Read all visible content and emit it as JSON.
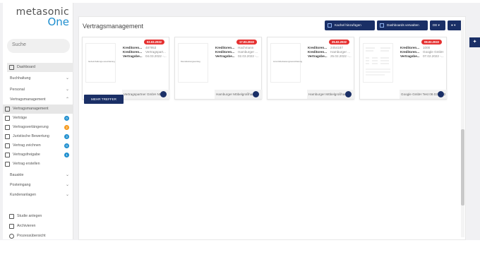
{
  "logo": {
    "top": "metasonic",
    "bottom": "One"
  },
  "search": {
    "placeholder": "Suche"
  },
  "sidebar": {
    "items": [
      {
        "label": "Dashboard"
      },
      {
        "label": "Buchhaltung"
      },
      {
        "label": "Personal"
      },
      {
        "label": "Vertragsmanagement"
      },
      {
        "label": "Vertragsmanagement"
      },
      {
        "label": "Verträge",
        "badge": "0"
      },
      {
        "label": "Vertragsverlängerung",
        "badge": "2"
      },
      {
        "label": "Juristische Bewertung",
        "badge": "3"
      },
      {
        "label": "Vertrag zeichnen",
        "badge": "0"
      },
      {
        "label": "Vertragsfreigabe",
        "badge": "1"
      },
      {
        "label": "Vertrag erstellen"
      },
      {
        "label": "Bauakte"
      },
      {
        "label": "Posteingang"
      },
      {
        "label": "Kundenanlagen"
      },
      {
        "label": "Studie anlegen"
      },
      {
        "label": "Archivieren"
      },
      {
        "label": "Prozessübersicht"
      }
    ]
  },
  "main": {
    "title": "Vertragsmanagement",
    "buttons": {
      "add_record": "Kachel hinzufügen",
      "manage_dashboards": "Dashboards verwalten",
      "lang": "DE",
      "user": "▾"
    },
    "cards": [
      {
        "date": "02.03.2022",
        "thumb_text": "Geheimhaltungs-vereinbarung",
        "fields": [
          {
            "k": "Kreditoren...",
            "v": "487953"
          },
          {
            "k": "Kreditoren...",
            "v": "Vertragspart..."
          },
          {
            "k": "Vertragsbe...",
            "v": "04.03.2022 -..."
          }
        ],
        "footer": "Vertragspartner GmbH NDA"
      },
      {
        "date": "17.03.2022",
        "thumb_text": "Dienstleistungsvertrag",
        "fields": [
          {
            "k": "Kreditoren...",
            "v": "Hachmann"
          },
          {
            "k": "Kreditoren...",
            "v": "Hamburger ..."
          },
          {
            "k": "Vertragsbe...",
            "v": "02.03.2022 -..."
          }
        ],
        "footer": "Hamburger Möbelgroßhandel"
      },
      {
        "date": "25.02.2022",
        "thumb_text": "Lizenzüberlassungsvereinbarung",
        "fields": [
          {
            "k": "Kreditoren...",
            "v": "2454187"
          },
          {
            "k": "Kreditoren...",
            "v": "Hamburger ..."
          },
          {
            "k": "Vertragsbe...",
            "v": "25.02.2022 -..."
          }
        ],
        "footer": "Hamburger Möbelgroßhandel"
      },
      {
        "date": "08.02.2022",
        "thumb_text": "",
        "fields": [
          {
            "k": "Kreditoren...",
            "v": "1000"
          },
          {
            "k": "Kreditoren...",
            "v": "Google GmbH"
          },
          {
            "k": "Vertragsbe...",
            "v": "07.02.2022 -..."
          }
        ],
        "footer": "Google GmbH Test 08.02.2022"
      }
    ],
    "more_button": "MEHR TREFFER"
  },
  "pin": {
    "icon": "pin-icon"
  },
  "colors": {
    "navy": "#1a2f66",
    "accent": "#1f8fcf",
    "badge_red": "#e53030",
    "badge_orange": "#f59a1f"
  }
}
